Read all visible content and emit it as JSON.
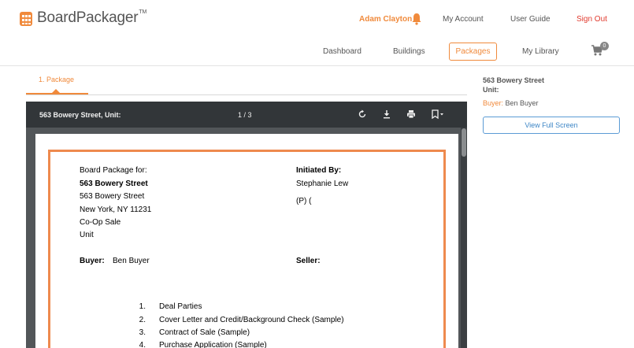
{
  "app": {
    "logo_text": "BoardPackager",
    "logo_mark": "TM",
    "brand_color": "#f08a3c"
  },
  "user_nav": {
    "user_name": "Adam Clayton",
    "my_account": "My Account",
    "user_guide": "User Guide",
    "sign_out": "Sign Out"
  },
  "main_nav": {
    "tabs": [
      {
        "label": "Dashboard",
        "active": false
      },
      {
        "label": "Buildings",
        "active": false
      },
      {
        "label": "Packages",
        "active": true
      },
      {
        "label": "My Library",
        "active": false
      }
    ],
    "cart_count": "0"
  },
  "steps": {
    "active_label": "1. Package"
  },
  "viewer": {
    "title": "563 Bowery Street, Unit:",
    "page_indicator": "1 / 3",
    "document": {
      "board_package_for_label": "Board Package for:",
      "address_bold": "563 Bowery Street",
      "address_line1": "563 Bowery Street",
      "address_line2": "New York, NY 11231",
      "sale_type": "Co-Op Sale",
      "unit_label": "Unit",
      "initiated_by_label": "Initiated By:",
      "initiator_name": "Stephanie Lew",
      "initiator_phone": "(P) (",
      "buyer_label": "Buyer:",
      "buyer_name": "Ben Buyer",
      "seller_label": "Seller:",
      "contents": [
        {
          "num": "1.",
          "text": "Deal Parties"
        },
        {
          "num": "2.",
          "text": "Cover Letter and Credit/Background Check (Sample)"
        },
        {
          "num": "3.",
          "text": "Contract of Sale (Sample)"
        },
        {
          "num": "4.",
          "text": "Purchase Application (Sample)"
        }
      ]
    }
  },
  "sidebar": {
    "address_line1": "563 Bowery Street",
    "address_line2": "Unit:",
    "buyer_label": "Buyer:",
    "buyer_name": "Ben Buyer",
    "full_screen_button": "View Full Screen"
  }
}
